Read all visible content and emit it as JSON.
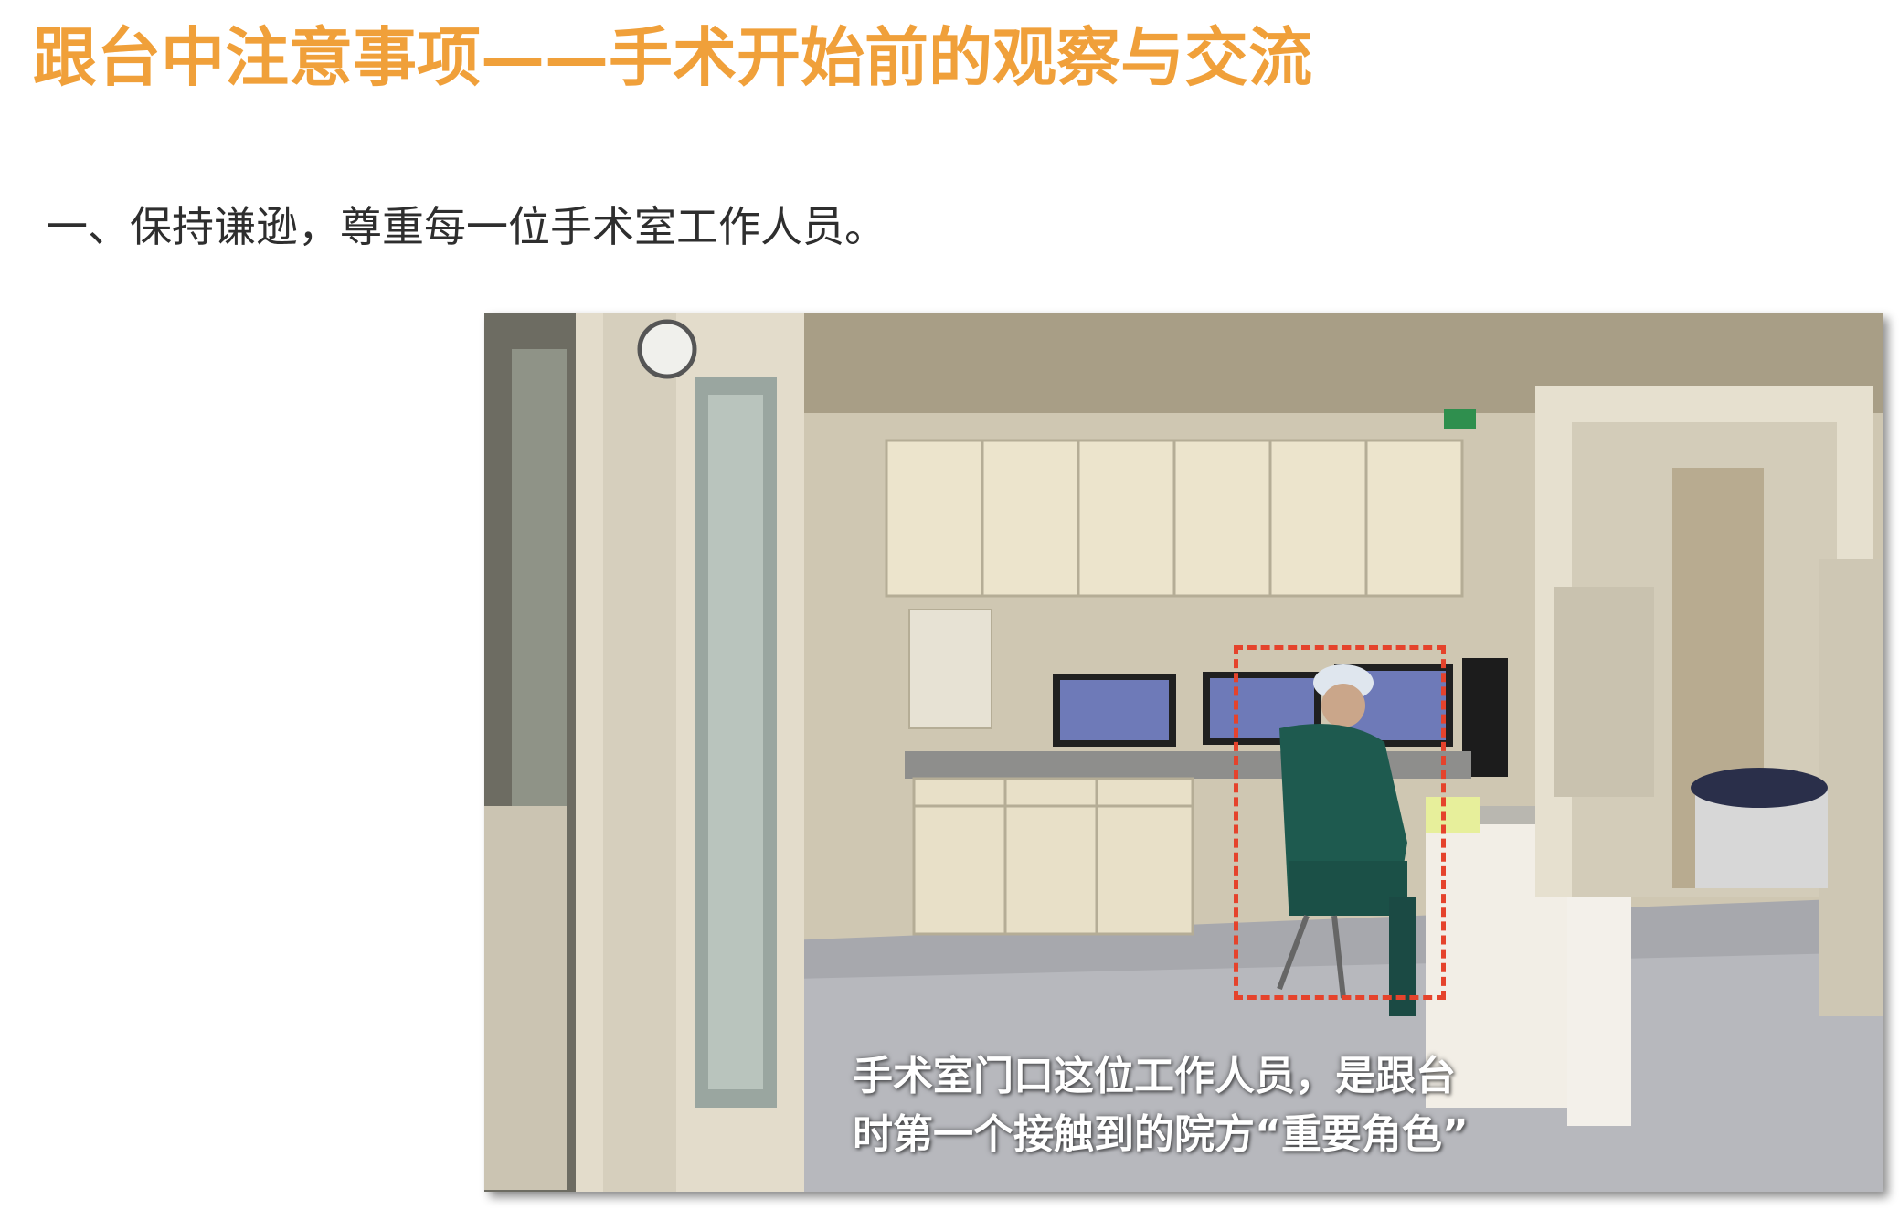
{
  "slide": {
    "title": "跟台中注意事项——手术开始前的观察与交流",
    "point": "一、保持谦逊，尊重每一位手术室工作人员。"
  },
  "photo": {
    "caption_line1": "手术室门口这位工作人员，是跟台",
    "caption_line2": "时第一个接触到的院方“重要角色”"
  },
  "colors": {
    "title": "#f0a03a",
    "point_text": "#2e2e2e",
    "highlight": "#e5432c",
    "caption": "#ffffff"
  }
}
